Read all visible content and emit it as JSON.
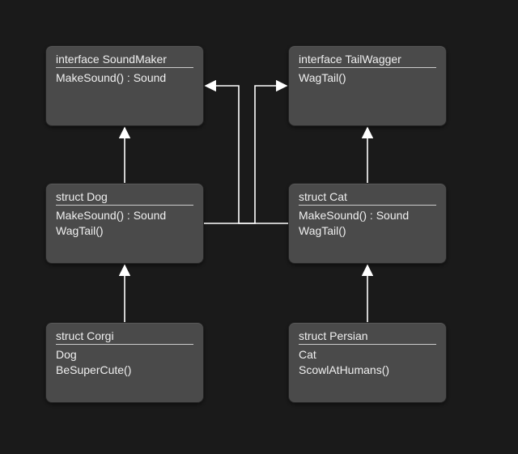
{
  "boxes": {
    "soundmaker": {
      "title": "interface SoundMaker",
      "lines": [
        "MakeSound() : Sound"
      ]
    },
    "tailwagger": {
      "title": "interface TailWagger",
      "lines": [
        "WagTail()"
      ]
    },
    "dog": {
      "title": "struct Dog",
      "lines": [
        "MakeSound() : Sound",
        "WagTail()"
      ]
    },
    "cat": {
      "title": "struct Cat",
      "lines": [
        "MakeSound() : Sound",
        "WagTail()"
      ]
    },
    "corgi": {
      "title": "struct Corgi",
      "lines": [
        "Dog",
        "BeSuperCute()"
      ]
    },
    "persian": {
      "title": "struct Persian",
      "lines": [
        "Cat",
        "ScowlAtHumans()"
      ]
    }
  }
}
